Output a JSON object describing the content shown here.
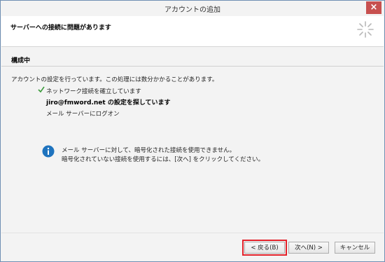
{
  "window": {
    "title": "アカウントの追加",
    "close_label": "×"
  },
  "header": {
    "title": "サーバーへの接続に問題があります"
  },
  "section": {
    "title": "構成中",
    "intro": "アカウントの設定を行っています。この処理には数分かかることがあります。",
    "steps": [
      {
        "label": "ネットワーク接続を確立しています",
        "status": "done"
      },
      {
        "label": "jiro@fmword.net の設定を探しています",
        "status": "current"
      },
      {
        "label": "メール サーバーにログオン",
        "status": "pending"
      }
    ]
  },
  "info": {
    "line1": "メール サーバーに対して、暗号化された接続を使用できません。",
    "line2": "暗号化されていない接続を使用するには、[次へ] をクリックしてください。"
  },
  "buttons": {
    "back": "< 戻る(B)",
    "next": "次へ(N) >",
    "cancel": "キャンセル"
  },
  "colors": {
    "highlight": "#e3222a",
    "info": "#1e73be",
    "check": "#3a9a3a"
  }
}
